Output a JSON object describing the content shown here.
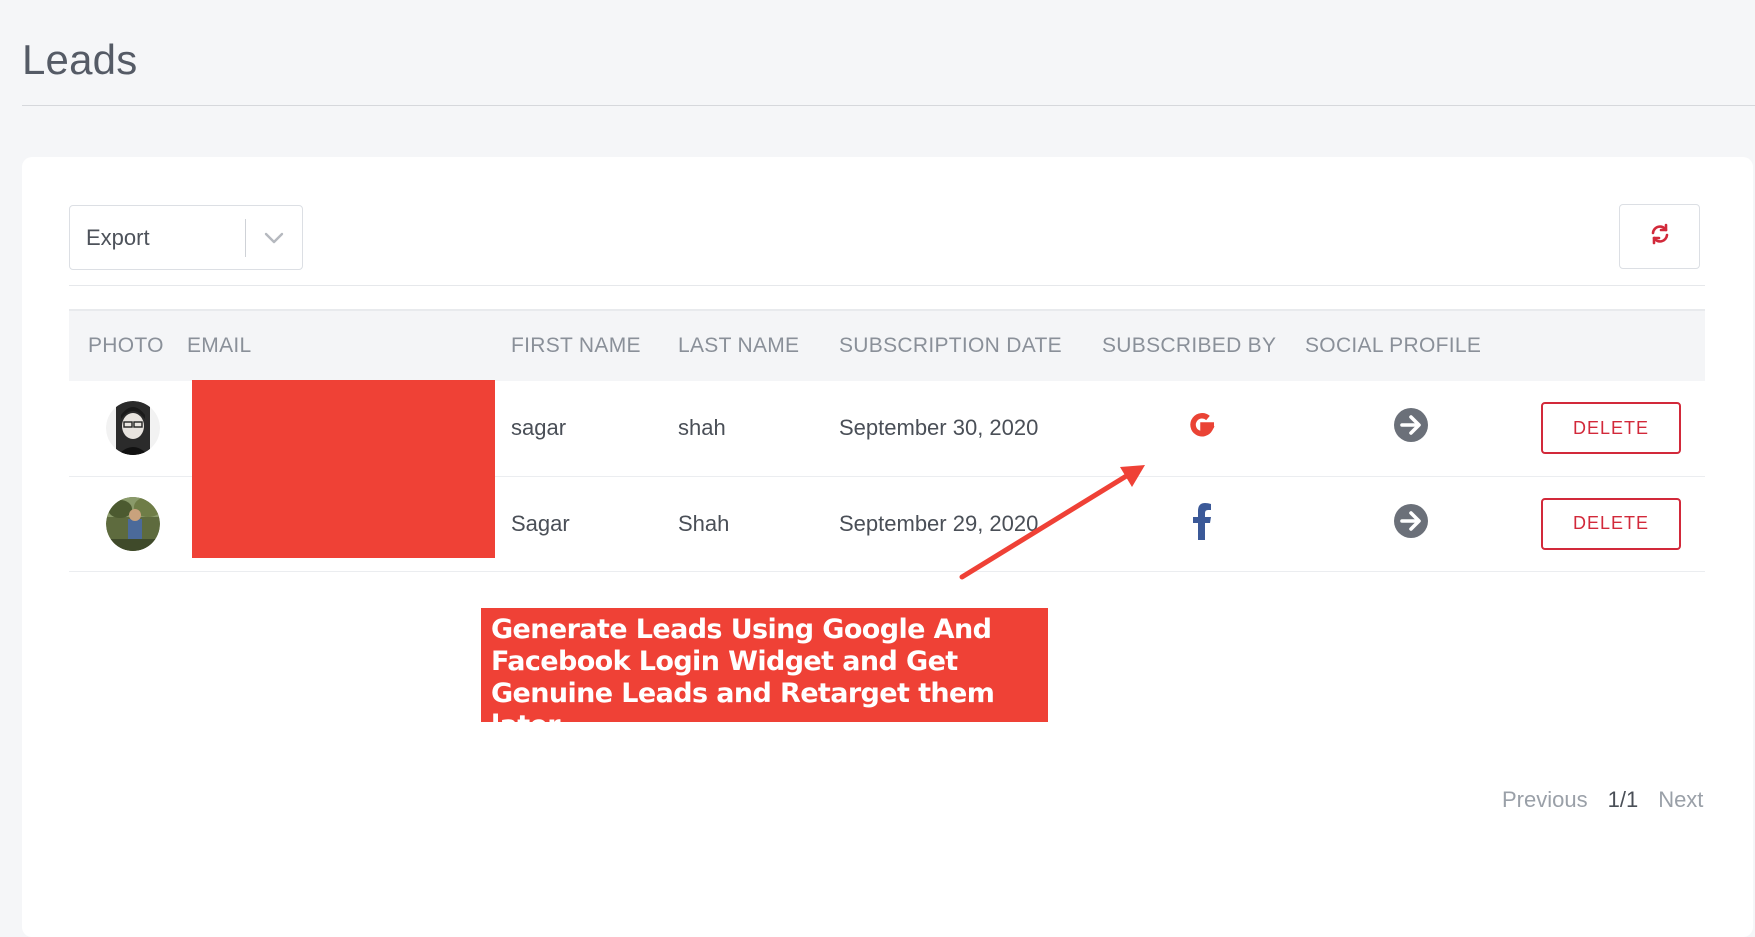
{
  "page": {
    "title": "Leads"
  },
  "toolbar": {
    "export_label": "Export",
    "refresh_icon": "refresh-icon"
  },
  "table": {
    "headers": {
      "photo": "PHOTO",
      "email": "EMAIL",
      "first_name": "FIRST NAME",
      "last_name": "LAST NAME",
      "subscription_date": "SUBSCRIPTION DATE",
      "subscribed_by": "SUBSCRIBED BY",
      "social_profile": "SOCIAL PROFILE"
    },
    "rows": [
      {
        "first_name": "sagar",
        "last_name": "shah",
        "subscription_date": "September 30, 2020",
        "subscribed_by_icon": "google-icon",
        "social_icon": "arrow-right-circle-icon",
        "delete_label": "DELETE"
      },
      {
        "first_name": "Sagar",
        "last_name": "Shah",
        "subscription_date": "September 29, 2020",
        "subscribed_by_icon": "facebook-icon",
        "social_icon": "arrow-right-circle-icon",
        "delete_label": "DELETE"
      }
    ]
  },
  "callout": {
    "text": "Generate Leads Using Google And Facebook Login Widget and Get Genuine Leads and Retarget them later."
  },
  "pagination": {
    "previous": "Previous",
    "page": "1/1",
    "next": "Next"
  },
  "colors": {
    "accent_red": "#ef4136",
    "delete_red": "#d2293a",
    "google_red": "#ea4335",
    "facebook_blue": "#3b5998",
    "icon_gray": "#6b7079"
  }
}
